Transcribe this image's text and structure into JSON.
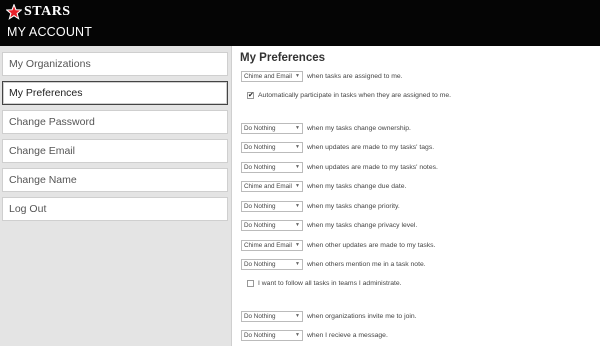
{
  "header": {
    "logo_text": "STARS",
    "account_title": "MY ACCOUNT",
    "colors": {
      "background": "#050505",
      "logo_star": "#e8202a"
    }
  },
  "sidebar": {
    "items": [
      {
        "label": "My Organizations",
        "active": false
      },
      {
        "label": "My Preferences",
        "active": true
      },
      {
        "label": "Change Password",
        "active": false
      },
      {
        "label": "Change Email",
        "active": false
      },
      {
        "label": "Change Name",
        "active": false
      },
      {
        "label": "Log Out",
        "active": false
      }
    ]
  },
  "main": {
    "title": "My Preferences",
    "rows": [
      {
        "select": "Chime and Email",
        "text": "when tasks are assigned to me."
      },
      {
        "checkbox": true,
        "text": "Automatically participate in tasks when they are assigned to me."
      },
      {
        "select": "Do Nothing",
        "text": "when my tasks change ownership."
      },
      {
        "select": "Do Nothing",
        "text": "when updates are made to my tasks' tags."
      },
      {
        "select": "Do Nothing",
        "text": "when updates are made to my tasks' notes."
      },
      {
        "select": "Chime and Email",
        "text": "when my tasks change due date."
      },
      {
        "select": "Do Nothing",
        "text": "when my tasks change priority."
      },
      {
        "select": "Do Nothing",
        "text": "when my tasks change privacy level."
      },
      {
        "select": "Chime and Email",
        "text": "when other updates are made to my tasks."
      },
      {
        "select": "Do Nothing",
        "text": "when others mention me in a task note."
      },
      {
        "checkbox": false,
        "text": "I want to follow all tasks in teams I administrate."
      },
      {
        "select": "Do Nothing",
        "text": "when organizations invite me to join."
      },
      {
        "select": "Do Nothing",
        "text": "when I recieve a message."
      }
    ]
  }
}
